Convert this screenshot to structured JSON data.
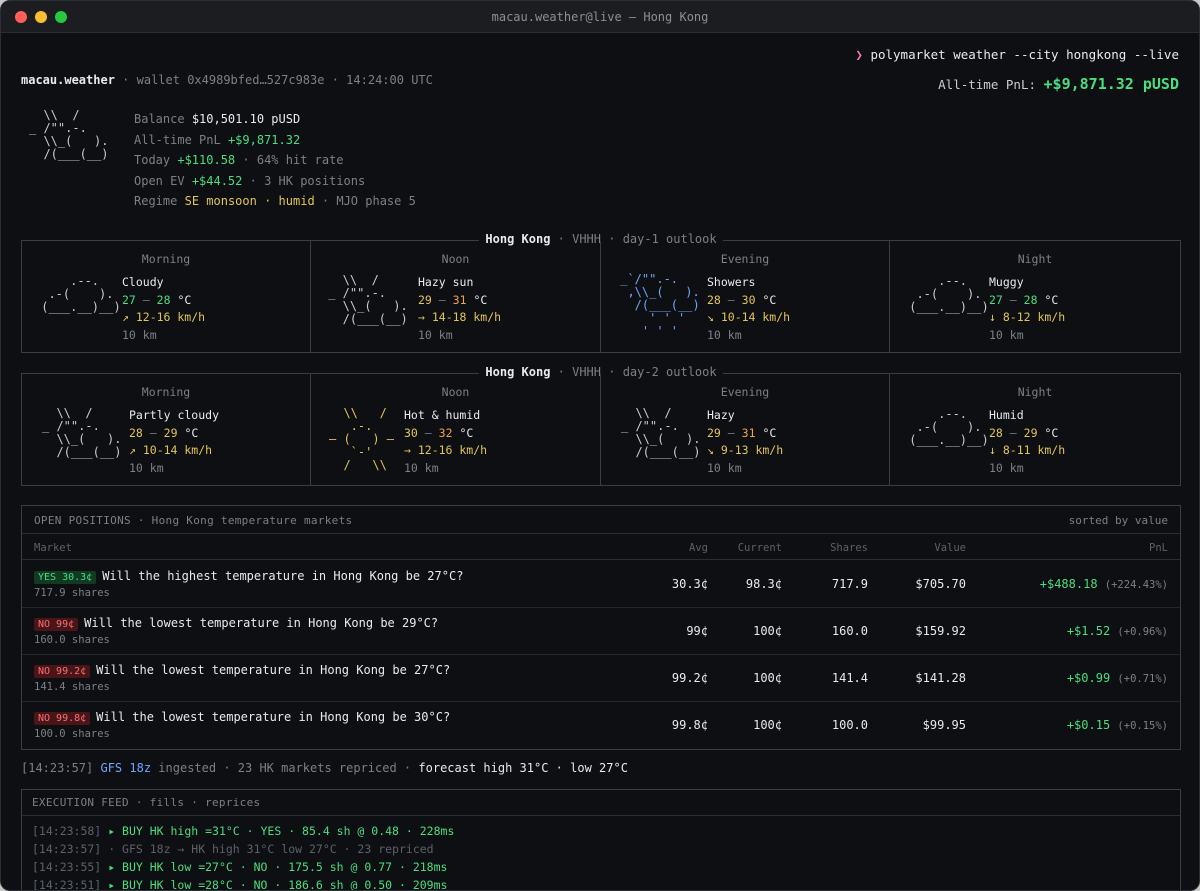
{
  "window": {
    "title": "macau.weather@live — Hong Kong"
  },
  "command": {
    "prompt": "❯",
    "text": "polymarket weather --city hongkong --live"
  },
  "header": {
    "app": "macau.weather",
    "sep": "·",
    "wallet": "wallet 0x4989bfed…527c983e",
    "time": "14:24:00 UTC",
    "pnl_label": "All-time PnL:",
    "pnl_value": "+$9,871.32 pUSD"
  },
  "summary": {
    "ascii": "  \\\\  /\n_ /\"\".-.\n  \\\\_(   ).\n  /(___(__)",
    "balance_label": "Balance",
    "balance_value": "$10,501.10 pUSD",
    "alltime_label": "All-time PnL",
    "alltime_value": "+$9,871.32",
    "today_label": "Today",
    "today_value": "+$110.58",
    "today_rest": "· 64% hit rate",
    "ev_label": "Open EV",
    "ev_value": "+$44.52",
    "ev_rest": "· 3 HK positions",
    "regime_label": "Regime",
    "regime_value1": "SE monsoon",
    "regime_sep": "·",
    "regime_value2": "humid",
    "regime_rest": "· MJO phase 5"
  },
  "outlooks": [
    {
      "city": "Hong Kong",
      "station": "· VHHH ·",
      "label": "day-1 outlook",
      "periods": [
        {
          "period": "Morning",
          "ascii": "     .--.\n  .-(    ).\n (___.__)__)",
          "cond": "Cloudy",
          "lo": "27",
          "dash": "–",
          "hi": "28",
          "unit": "°C",
          "wind": "↗ 12-16 km/h",
          "vis": "10 km",
          "lo_color": "#4ade80",
          "hi_color": "#4ade80",
          "ascii_color": "#c9ccd1"
        },
        {
          "period": "Noon",
          "ascii": "   \\\\  /\n _ /\"\".-.\n   \\\\_(   ).\n   /(___(__)",
          "cond": "Hazy sun",
          "lo": "29",
          "dash": "–",
          "hi": "31",
          "unit": "°C",
          "wind": "→ 14-18 km/h",
          "vis": "10 km",
          "lo_color": "#e2c55a",
          "hi_color": "#f0a34a",
          "ascii_color": "#c9ccd1"
        },
        {
          "period": "Evening",
          "ascii": " _`/\"\".-.\n  ,\\\\_(   ).\n   /(___(__)\n     ' ' '\n    ' ' '",
          "cond": "Showers",
          "lo": "28",
          "dash": "–",
          "hi": "30",
          "unit": "°C",
          "wind": "↘ 10-14 km/h",
          "vis": "10 km",
          "lo_color": "#e2c55a",
          "hi_color": "#e2c55a",
          "ascii_color": "#6ea8fe"
        },
        {
          "period": "Night",
          "ascii": "     .--.\n  .-(    ).\n (___.__)__)",
          "cond": "Muggy",
          "lo": "27",
          "dash": "–",
          "hi": "28",
          "unit": "°C",
          "wind": "↓ 8-12 km/h",
          "vis": "10 km",
          "lo_color": "#4ade80",
          "hi_color": "#4ade80",
          "ascii_color": "#c9ccd1"
        }
      ]
    },
    {
      "city": "Hong Kong",
      "station": "· VHHH ·",
      "label": "day-2 outlook",
      "periods": [
        {
          "period": "Morning",
          "ascii": "  \\\\  /\n_ /\"\".-.\n  \\\\_(   ).\n  /(___(__)",
          "cond": "Partly cloudy",
          "lo": "28",
          "dash": "–",
          "hi": "29",
          "unit": "°C",
          "wind": "↗ 10-14 km/h",
          "vis": "10 km",
          "lo_color": "#e2c55a",
          "hi_color": "#e2c55a",
          "ascii_color": "#c9ccd1"
        },
        {
          "period": "Noon",
          "ascii": "  \\\\   /\n   .-.\n― (   ) ―\n   `-'\n  /   \\\\",
          "cond": "Hot & humid",
          "lo": "30",
          "dash": "–",
          "hi": "32",
          "unit": "°C",
          "wind": "→ 12-16 km/h",
          "vis": "10 km",
          "lo_color": "#e2c55a",
          "hi_color": "#f0a34a",
          "ascii_color": "#e2c55a"
        },
        {
          "period": "Evening",
          "ascii": "  \\\\  /\n_ /\"\".-.\n  \\\\_(   ).\n  /(___(__)",
          "cond": "Hazy",
          "lo": "29",
          "dash": "–",
          "hi": "31",
          "unit": "°C",
          "wind": "↘ 9-13 km/h",
          "vis": "10 km",
          "lo_color": "#e2c55a",
          "hi_color": "#f0a34a",
          "ascii_color": "#c9ccd1"
        },
        {
          "period": "Night",
          "ascii": "     .--.\n  .-(    ).\n (___.__)__)",
          "cond": "Humid",
          "lo": "28",
          "dash": "–",
          "hi": "29",
          "unit": "°C",
          "wind": "↓ 8-11 km/h",
          "vis": "10 km",
          "lo_color": "#e2c55a",
          "hi_color": "#e2c55a",
          "ascii_color": "#c9ccd1"
        }
      ]
    }
  ],
  "positions": {
    "title": "OPEN POSITIONS · Hong Kong temperature markets",
    "sort": "sorted by value",
    "columns": {
      "market": "Market",
      "avg": "Avg",
      "current": "Current",
      "shares": "Shares",
      "value": "Value",
      "pnl": "PnL"
    },
    "rows": [
      {
        "side": "YES",
        "badge": "YES 30.3¢",
        "question": "Will the highest temperature in Hong Kong be 27°C?",
        "shares_label": "717.9 shares",
        "avg": "30.3¢",
        "current": "98.3¢",
        "shares": "717.9",
        "value": "$705.70",
        "pnl": "+$488.18",
        "pnl_pct": "(+224.43%)"
      },
      {
        "side": "NO",
        "badge": "NO 99¢",
        "question": "Will the lowest temperature in Hong Kong be 29°C?",
        "shares_label": "160.0 shares",
        "avg": "99¢",
        "current": "100¢",
        "shares": "160.0",
        "value": "$159.92",
        "pnl": "+$1.52",
        "pnl_pct": "(+0.96%)"
      },
      {
        "side": "NO",
        "badge": "NO 99.2¢",
        "question": "Will the lowest temperature in Hong Kong be 27°C?",
        "shares_label": "141.4 shares",
        "avg": "99.2¢",
        "current": "100¢",
        "shares": "141.4",
        "value": "$141.28",
        "pnl": "+$0.99",
        "pnl_pct": "(+0.71%)"
      },
      {
        "side": "NO",
        "badge": "NO 99.8¢",
        "question": "Will the lowest temperature in Hong Kong be 30°C?",
        "shares_label": "100.0 shares",
        "avg": "99.8¢",
        "current": "100¢",
        "shares": "100.0",
        "value": "$99.95",
        "pnl": "+$0.15",
        "pnl_pct": "(+0.15%)"
      }
    ]
  },
  "status": {
    "time": "[14:23:57]",
    "model": "GFS 18z",
    "text": "ingested · 23 HK markets repriced ·",
    "forecast": "forecast high 31°C · low 27°C"
  },
  "feed": {
    "title": "EXECUTION FEED · fills · reprices",
    "lines": [
      {
        "time": "[14:23:58]",
        "text": "▸ BUY HK high =31°C · YES · 85.4 sh @ 0.48 · 228ms",
        "kind": "fill"
      },
      {
        "time": "[14:23:57]",
        "text": "· GFS 18z → HK high 31°C low 27°C · 23 repriced",
        "kind": "info"
      },
      {
        "time": "[14:23:55]",
        "text": "▸ BUY HK low =27°C · NO · 175.5 sh @ 0.77 · 218ms",
        "kind": "fill"
      },
      {
        "time": "[14:23:51]",
        "text": "▸ BUY HK low =28°C · NO · 186.6 sh @ 0.50 · 209ms",
        "kind": "fill"
      }
    ]
  },
  "colors": {
    "accent_green": "#4ade80",
    "accent_yellow": "#e2c55a",
    "accent_orange": "#f0a34a",
    "accent_blue": "#6ea8fe",
    "no_red": "#f87171",
    "prompt_pink": "#f472b6"
  }
}
